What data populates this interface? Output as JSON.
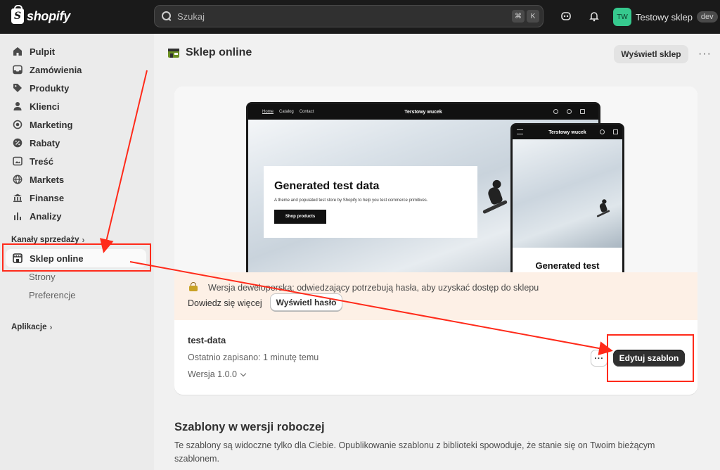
{
  "topbar": {
    "logo_text": "shopify",
    "logo_mark": "S",
    "search_placeholder": "Szukaj",
    "kbd_cmd": "⌘",
    "kbd_key": "K",
    "store_initials": "TW",
    "store_name": "Testowy sklep",
    "store_badge": "dev"
  },
  "sidebar": {
    "items": [
      {
        "label": "Pulpit",
        "icon": "home-icon"
      },
      {
        "label": "Zamówienia",
        "icon": "inbox-icon"
      },
      {
        "label": "Produkty",
        "icon": "tag-icon"
      },
      {
        "label": "Klienci",
        "icon": "person-icon"
      },
      {
        "label": "Marketing",
        "icon": "target-icon"
      },
      {
        "label": "Rabaty",
        "icon": "discount-icon"
      },
      {
        "label": "Treść",
        "icon": "content-icon"
      },
      {
        "label": "Markets",
        "icon": "globe-icon"
      },
      {
        "label": "Finanse",
        "icon": "bank-icon"
      },
      {
        "label": "Analizy",
        "icon": "chart-icon"
      }
    ],
    "sales_channels_label": "Kanały sprzedaży",
    "online_store_label": "Sklep online",
    "sub_items": [
      "Strony",
      "Preferencje"
    ],
    "apps_label": "Aplikacje"
  },
  "page": {
    "title": "Sklep online",
    "view_store_button": "Wyświetl sklep",
    "more_label": "···"
  },
  "preview": {
    "nav_links": [
      "Home",
      "Catalog",
      "Contact"
    ],
    "desktop_brand": "Terstowy wucek",
    "mobile_brand": "Terstowy wucek",
    "hero_title": "Generated test data",
    "hero_text": "A theme and populated test store by Shopify to help you test commerce primitives.",
    "hero_button": "Shop products",
    "mobile_hero_title": "Generated test"
  },
  "banner": {
    "message": "Wersja deweloperska: odwiedzający potrzebują hasła, aby uzyskać dostęp do sklepu",
    "learn_more": "Dowiedz się więcej",
    "show_password_button": "Wyświetl hasło"
  },
  "theme": {
    "name": "test-data",
    "saved": "Ostatnio zapisano: 1 minutę temu",
    "version": "Wersja 1.0.0",
    "more_label": "···",
    "edit_button": "Edytuj szablon"
  },
  "drafts": {
    "title": "Szablony w wersji roboczej",
    "description": "Te szablony są widoczne tylko dla Ciebie. Opublikowanie szablonu z biblioteki spowoduje, że stanie się on Twoim bieżącym szablonem."
  },
  "colors": {
    "annotation": "#ff2a1a",
    "topbar": "#1a1a1a",
    "banner": "#fdf0e6",
    "primary_button": "#303030"
  }
}
